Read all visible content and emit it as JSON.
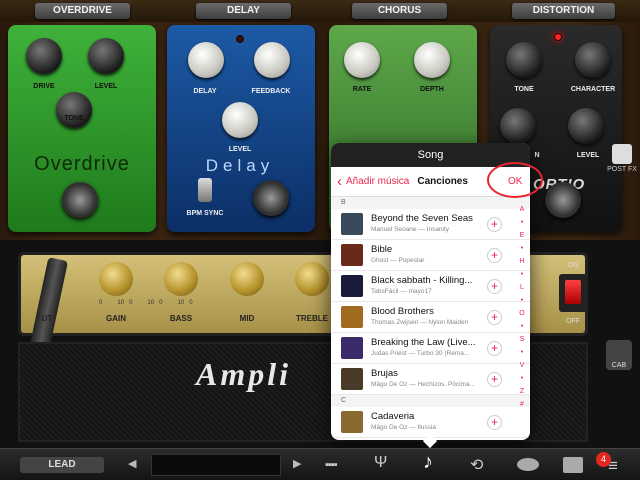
{
  "pedal_tabs": [
    "OVERDRIVE",
    "DELAY",
    "CHORUS",
    "DISTORTION"
  ],
  "overdrive": {
    "name": "Overdrive",
    "drive": "DRIVE",
    "level": "LEVEL",
    "tone": "TONE"
  },
  "delay": {
    "name": "Delay",
    "delay": "DELAY",
    "feedback": "FEEDBACK",
    "level": "LEVEL",
    "bpm_sync": "BPM SYNC"
  },
  "chorus": {
    "rate": "RATE",
    "depth": "DEPTH"
  },
  "distortion": {
    "tone": "TONE",
    "character": "CHARACTER",
    "level": "LEVEL",
    "name_fragment": "ORTIO",
    "low_partial": "N"
  },
  "post_fx": "POST FX",
  "amp": {
    "logo_fragment": "Ampli",
    "out_fragment": "UT",
    "knobs": [
      "GAIN",
      "BASS",
      "MID",
      "TREBLE"
    ],
    "scale": [
      "0",
      "10",
      "0",
      "10",
      "0",
      "10",
      "0"
    ],
    "switch_on": "ON",
    "switch_off": "OFF",
    "cab": "CAB"
  },
  "popup": {
    "title": "Song",
    "back_label": "Añadir música",
    "section_title": "Canciones",
    "ok_label": "OK",
    "section_b": "B",
    "section_c": "C",
    "songs": [
      {
        "title": "Beyond the Seven Seas",
        "sub": "Manuel Seoane — Insanity",
        "color": "#3a4a5a"
      },
      {
        "title": "Bible",
        "sub": "Ghost — Popestar",
        "color": "#6a2a1a"
      },
      {
        "title": "Black sabbath - Killing...",
        "sub": "TabsFácil — mayo17",
        "color": "#1a1a3a"
      },
      {
        "title": "Blood Brothers",
        "sub": "Thomas Zwijsen — Nylon Maiden",
        "color": "#a06a20"
      },
      {
        "title": "Breaking the Law (Live...",
        "sub": "Judas Priest — Turbo 30 (Rema...",
        "color": "#3a2a6a"
      },
      {
        "title": "Brujas",
        "sub": "Mägo De Oz — Hechizos, Pócima...",
        "color": "#4a3a2a"
      },
      {
        "title": "Cadaveria",
        "sub": "Mägo De Oz — Ilussia",
        "color": "#8a6a30"
      }
    ],
    "index": [
      "A",
      "•",
      "E",
      "•",
      "H",
      "•",
      "L",
      "•",
      "O",
      "•",
      "S",
      "•",
      "V",
      "•",
      "Z",
      "#"
    ]
  },
  "bottom": {
    "preset": "LEAD",
    "badge": "4"
  }
}
